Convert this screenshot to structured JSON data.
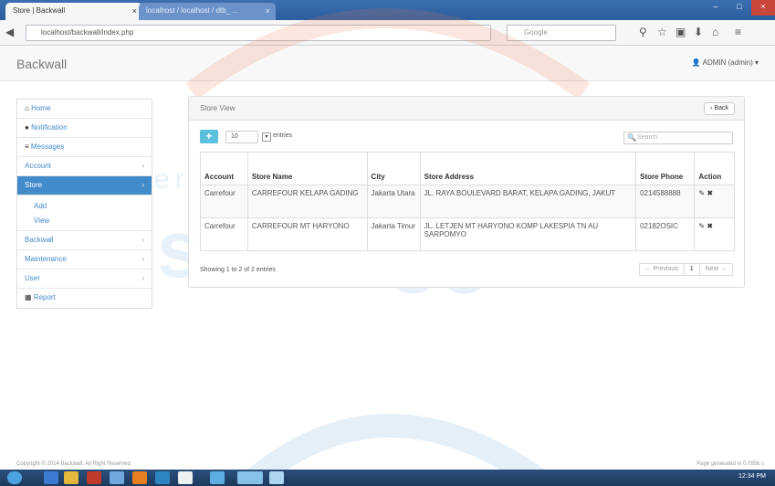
{
  "browser": {
    "tabs": [
      {
        "label": "Store | Backwall"
      },
      {
        "label": "localhost / localhost / dtb_ ..."
      }
    ],
    "url": "localhost/backwall/index.php",
    "search_placeholder": "Google"
  },
  "header": {
    "brand": "Backwall",
    "user": "ADMIN (admin)"
  },
  "sidebar": {
    "items": [
      {
        "label": "Home",
        "icon": "home-icon"
      },
      {
        "label": "Notification",
        "icon": "bell-icon"
      },
      {
        "label": "Messages",
        "icon": "list-icon"
      },
      {
        "label": "Account"
      },
      {
        "label": "Store"
      },
      {
        "label": "Backwall"
      },
      {
        "label": "Maintenance"
      },
      {
        "label": "User"
      },
      {
        "label": "Report",
        "icon": "chart-icon"
      }
    ],
    "store_sub": [
      "Add",
      "View"
    ]
  },
  "panel": {
    "title": "Store View",
    "back_label": "Back",
    "add_label": "+",
    "length_value": "10",
    "length_label": "entries",
    "search_placeholder": "Search",
    "columns": [
      "Account",
      "Store Name",
      "City",
      "Store Address",
      "Store Phone",
      "Action"
    ],
    "rows": [
      {
        "account": "Carrefour",
        "store_name": "CARREFOUR KELAPA GADING",
        "city": "Jakarta Utara",
        "address": "JL. RAYA BOULEVARD BARAT, KELAPA GADING, JAKUT",
        "phone": "0214588888",
        "action": "✎ ✖"
      },
      {
        "account": "Carrefour",
        "store_name": "CARREFOUR MT HARYONO",
        "city": "Jakarta Timur",
        "address": "JL. LETJEN MT HARYONO KOMP LAKESPIA TN AU SARPOMYO",
        "phone": "02182OSIC",
        "action": "✎ ✖"
      }
    ],
    "info": "Showing 1 to 2 of 2 entries",
    "pager": {
      "prev": "← Previous",
      "current": "1",
      "next": "Next →"
    }
  },
  "footer": {
    "left": "Copyright © 2014 Backwall. All Right Reserved",
    "right": "Page generated in 0.0956 s"
  },
  "taskbar": {
    "clock": "12:34 PM"
  },
  "watermark": {
    "top": "Universitas",
    "bottom": "Esa Unggul"
  },
  "colors": {
    "primary": "#428bca",
    "info": "#5bc0de"
  }
}
